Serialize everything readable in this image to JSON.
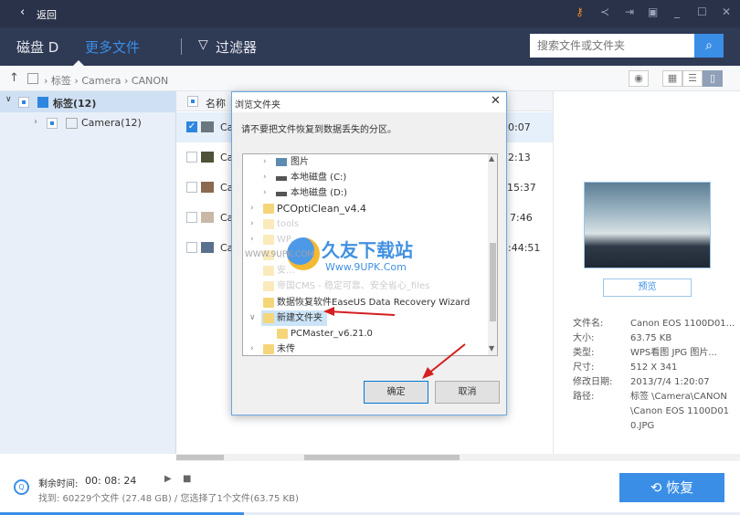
{
  "titlebar": {
    "back_label": "返回",
    "icons": [
      "key-icon",
      "share-icon",
      "exit-icon",
      "menu-icon",
      "minimize-icon",
      "maximize-icon",
      "close-icon"
    ],
    "accent": "#e88a2a"
  },
  "header": {
    "tabs": [
      {
        "label": "磁盘 D"
      },
      {
        "label": "更多文件"
      }
    ],
    "filter_label": "过滤器",
    "search_placeholder": "搜索文件或文件夹",
    "accent": "#3a8ee6"
  },
  "breadcrumb": [
    "标签",
    "Camera",
    "CANON"
  ],
  "tree": [
    {
      "label": "标签(12)"
    },
    {
      "label": "Camera(12)"
    }
  ],
  "list": {
    "column_name": "名称",
    "rows": [
      {
        "name": "Ca",
        "time": "0:07",
        "checked": true
      },
      {
        "name": "Ca",
        "time": "2:13"
      },
      {
        "name": "Ca",
        "time": "15:37"
      },
      {
        "name": "Ca",
        "time": "7:46"
      },
      {
        "name": "Ca",
        "time": "3:44:51"
      }
    ]
  },
  "detail": {
    "preview_label": "预览",
    "fields": [
      {
        "k": "文件名:",
        "v": "Canon EOS 1100D01..."
      },
      {
        "k": "大小:",
        "v": "63.75 KB"
      },
      {
        "k": "类型:",
        "v": "WPS看图 JPG 图片..."
      },
      {
        "k": "尺寸:",
        "v": "512 X 341"
      },
      {
        "k": "修改日期:",
        "v": "2013/7/4 1:20:07"
      },
      {
        "k": "路径:",
        "v": "标签 \\Camera\\CANON\\Canon EOS 1100D010.JPG"
      }
    ]
  },
  "dialog": {
    "title": "浏览文件夹",
    "message": "请不要把文件恢复到数据丢失的分区。",
    "items": [
      "图片",
      "本地磁盘 (C:)",
      "本地磁盘 (D:)",
      "PCOptiClean_v4.4",
      "tools",
      "WP...",
      "...",
      "安...",
      "帝国CMS - 稳定可靠、安全省心_files",
      "数据恢复软件EaseUS Data Recovery Wizard",
      "新建文件夹",
      "PCMaster_v6.21.0",
      "未传"
    ],
    "ok_label": "确定",
    "cancel_label": "取消"
  },
  "watermark": {
    "title": "久友下载站",
    "url": "Www.9UPK.Com",
    "side": "WWW.9UPK.COM"
  },
  "footer": {
    "remaining_label": "剩余时间:",
    "remaining_value": "00: 08: 24",
    "found_text": "找到: 60229个文件 (27.48 GB) / 您选择了1个文件(63.75 KB)",
    "recover_label": "恢复",
    "progress": 0.33
  }
}
